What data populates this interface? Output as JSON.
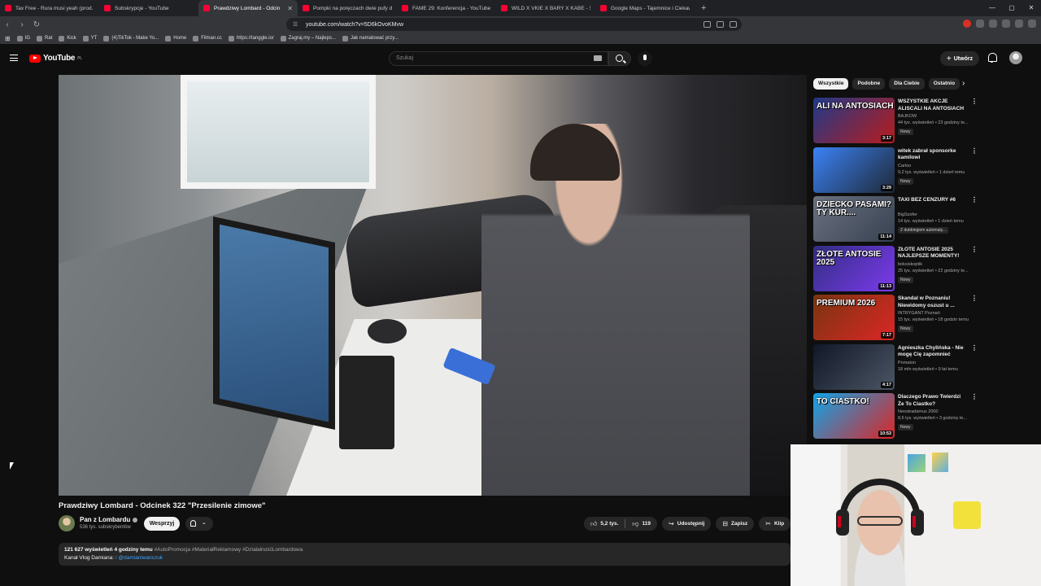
{
  "browser": {
    "tabs": [
      {
        "title": "Tax Free - Rura musi yeah (prod. CUT",
        "icon": "youtube",
        "active": false
      },
      {
        "title": "Subskrypcje - YouTube",
        "icon": "youtube",
        "active": false
      },
      {
        "title": "Prawdziwy Lombard - Odcin",
        "icon": "youtube",
        "active": true
      },
      {
        "title": "Pompki na poręczach dwie pufy drog",
        "icon": "youtube",
        "active": false
      },
      {
        "title": "FAME 29: Konferencja - YouTube",
        "icon": "youtube",
        "active": false
      },
      {
        "title": "WILD X VKIE X BARY X KABE - SZLAM",
        "icon": "youtube",
        "active": false
      },
      {
        "title": "Google Maps - Tajemnice i Ciekawe",
        "icon": "youtube",
        "active": false
      }
    ],
    "url": "youtube.com/watch?v=5D6kOvoKMvw",
    "bookmarks": [
      "IG",
      "Rat",
      "Kick",
      "YT",
      "(4)TikTok - Make Yo...",
      "Home",
      "Filman.cc",
      "https://tanggle.io/",
      "Zagraj.my – Najleps...",
      "Jak namalować przy..."
    ]
  },
  "header": {
    "logo": "YouTube",
    "region": "PL",
    "search_placeholder": "Szukaj",
    "create_label": "Utwórz"
  },
  "video": {
    "title": "Prawdziwy Lombard - Odcinek 322 \"Przesilenie zimowe\"",
    "channel": "Pan z Lombardu",
    "subscribers": "536 tys. subskrybentów",
    "support_label": "Wesprzyj",
    "likes": "5,2 tys.",
    "dislikes": "119",
    "share_label": "Udostępnij",
    "save_label": "Zapisz",
    "clip_label": "Klip",
    "views": "121 627 wyświetleń",
    "age": "4 godziny temu",
    "hashtags": "#AutoPromocja #MateriałReklamowy #DziałalnośćLombardowa",
    "desc_line2_prefix": "Kanał Vlog Damiana:",
    "desc_line2_link": "/ @damianiwanczuk"
  },
  "chips": [
    "Wszystkie",
    "Podobne",
    "Dla Ciebie",
    "Ostatnio"
  ],
  "recommendations": [
    {
      "title": "WSZYSTKIE AKCJE ALISCALI NA ANTOSIACH",
      "channel": "BAJKOW",
      "stats": "44 tys. wyświetleń • 23 godziny te...",
      "badge": "Nowy",
      "duration": "3:17",
      "thumb_text": "ALI NA ANTOSIACH",
      "c1": "#1e3a8a",
      "c2": "#b91c1c"
    },
    {
      "title": "witek zabrał sponsorke kamilowi",
      "channel": "Carloo",
      "stats": "9,2 tys. wyświetleń • 1 dzień temu",
      "badge": "Nowy",
      "duration": "3:29",
      "thumb_text": "",
      "c1": "#3b82f6",
      "c2": "#1f2937"
    },
    {
      "title": "TAXI BEZ CENZURY #6",
      "channel": "BigSzofer",
      "stats": "14 tys. wyświetleń • 1 dzień temu",
      "badge": "Z dubbingiem automaty...",
      "duration": "11:14",
      "thumb_text": "DZIECKO PASAMI? TY KUR....",
      "c1": "#6b7280",
      "c2": "#374151"
    },
    {
      "title": "ZŁOTE ANTOSIE 2025 NAJLEPSZE MOMENTY!",
      "channel": "boksiskoptik",
      "stats": "25 tys. wyświetleń • 22 godziny te...",
      "badge": "Nowy",
      "duration": "11:13",
      "thumb_text": "ZŁOTE ANTOSIE 2025",
      "c1": "#312e81",
      "c2": "#7c3aed"
    },
    {
      "title": "Skandal w Poznaniu! Niewidomy oszust u ...",
      "channel": "INTRYGANT Poznań",
      "stats": "15 tys. wyświetleń • 18 godzin temu",
      "badge": "Nowy",
      "duration": "7:17",
      "thumb_text": "PREMIUM 2026",
      "c1": "#78350f",
      "c2": "#dc2626"
    },
    {
      "title": "Agnieszka Chylińska - Nie mogę Cię zapomnieć",
      "channel": "Pomaton",
      "stats": "18 mln wyświetleń • 9 lat temu",
      "badge": "",
      "duration": "4:17",
      "thumb_text": "",
      "c1": "#111827",
      "c2": "#4b5563"
    },
    {
      "title": "Dlaczego Prawo Twierdzi Że To Ciastko?",
      "channel": "Neostradamus 2000",
      "stats": "8,6 tys. wyświetleń • 3 godziny te...",
      "badge": "Nowy",
      "duration": "10:53",
      "thumb_text": "TO CIASTKO!",
      "c1": "#0ea5e9",
      "c2": "#dc2626"
    }
  ]
}
